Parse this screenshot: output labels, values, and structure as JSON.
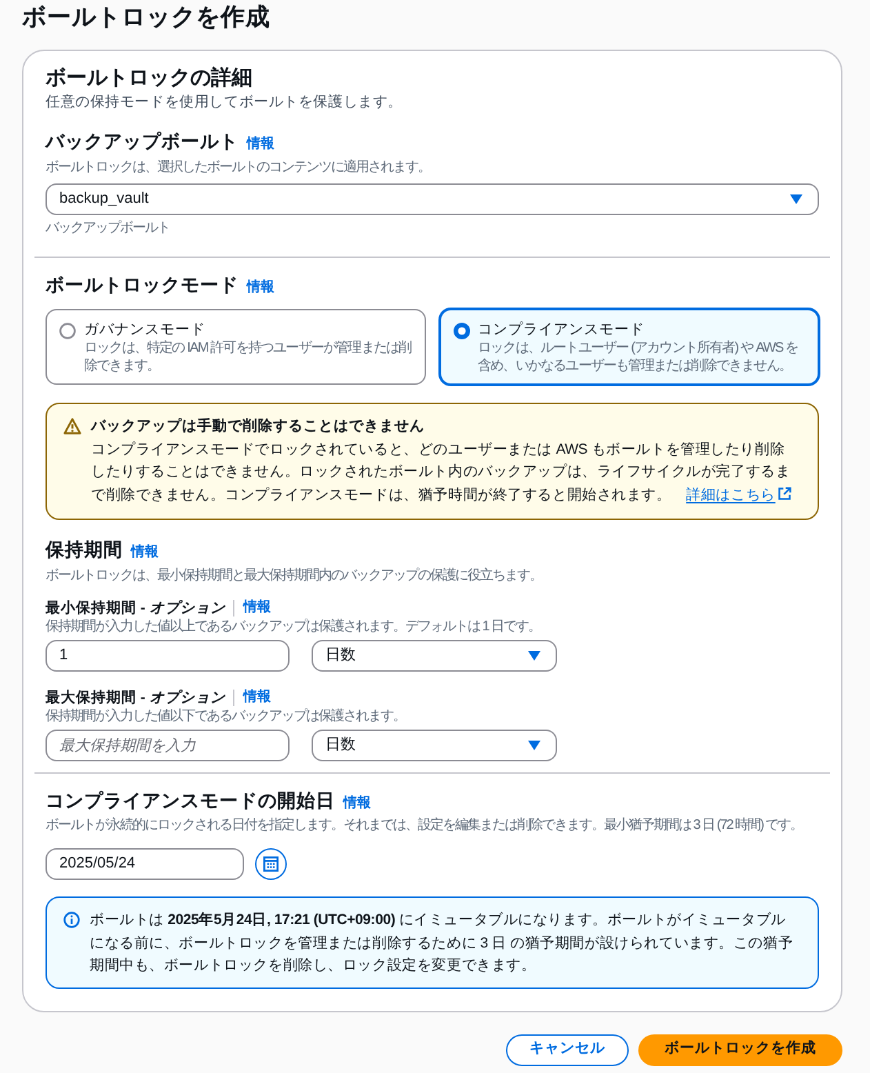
{
  "page": {
    "title": "ボールトロックを作成"
  },
  "details": {
    "title": "ボールトロックの詳細",
    "description": "任意の保持モードを使用してボールトを保護します。",
    "vault_field": {
      "label": "バックアップボールト",
      "info": "情報",
      "description": "ボールトロックは、選択したボールトのコンテンツに適用されます。",
      "value": "backup_vault",
      "constraint": "バックアップボールト"
    }
  },
  "mode": {
    "label": "ボールトロックモード",
    "info": "情報",
    "options": [
      {
        "title": "ガバナンスモード",
        "description": "ロックは、特定の IAM 許可を持つユーザーが管理または削除できます。",
        "selected": false
      },
      {
        "title": "コンプライアンスモード",
        "description": "ロックは、ルートユーザー (アカウント所有者) や AWS を含め、いかなるユーザーも管理または削除できません。",
        "selected": true
      }
    ],
    "alert": {
      "kind": "warning",
      "title": "バックアップは手動で削除することはできません",
      "text": "コンプライアンスモードでロックされていると、どのユーザーまたは AWS もボールトを管理したり削除したりすることはできません。ロックされたボールト内のバックアップは、ライフサイクルが完了するまで削除できません。コンプライアンスモードは、猶予時間が終了すると開始されます。",
      "link": "詳細はこちら"
    }
  },
  "retention": {
    "label": "保持期間",
    "info": "情報",
    "description": "ボールトロックは、最小保持期間と最大保持期間内のバックアップの保護に役立ちます。",
    "fields": [
      {
        "label": "最小保持期間 - *オプション*",
        "info": "情報",
        "description": "保持期間が入力した値以上であるバックアップは保護されます。デフォルトは 1 日です。",
        "value": "1",
        "unit": "日数"
      },
      {
        "label": "最大保持期間 - *オプション*",
        "info": "情報",
        "description": "保持期間が入力した値以下であるバックアップは保護されます。",
        "placeholder": "最大保持期間を入力",
        "unit": "日数"
      }
    ]
  },
  "start_date": {
    "label": "コンプライアンスモードの開始日",
    "info": "情報",
    "description": "ボールトが永続的にロックされる日付を指定します。それまでは、設定を編集または削除できます。最小猶予期間は 3 日 (72 時間) です。",
    "value": "2025/05/24",
    "alert": {
      "kind": "info",
      "text": "ボールトは **2025年5月24日, 17:21 (UTC+09:00)** にイミュータブルになります。ボールトがイミュータブルになる前に、ボールトロックを管理または削除するために 3 日 の猶予期間が設けられています。この猶予期間中も、ボールトロックを削除し、ロック設定を変更できます。"
    }
  },
  "buttons": [
    {
      "label": "キャンセル",
      "kind": "secondary"
    },
    {
      "label": "ボールトロックを作成",
      "kind": "primary"
    }
  ]
}
